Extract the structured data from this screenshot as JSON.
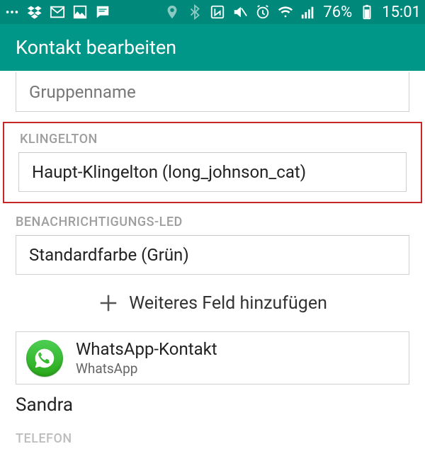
{
  "status": {
    "battery_percent": "76%",
    "clock": "15:01"
  },
  "header": {
    "title": "Kontakt bearbeiten"
  },
  "fields": {
    "group_name_placeholder": "Gruppenname",
    "ringtone_label": "KLINGELTON",
    "ringtone_value": "Haupt-Klingelton (long_johnson_cat)",
    "led_label": "BENACHRICHTIGUNGS-LED",
    "led_value": "Standardfarbe (Grün)",
    "add_field": "Weiteres Feld hinzufügen"
  },
  "whatsapp": {
    "title": "WhatsApp-Kontakt",
    "subtitle": "WhatsApp"
  },
  "contact_name": "Sandra",
  "cutoff_label": "TELEFON"
}
